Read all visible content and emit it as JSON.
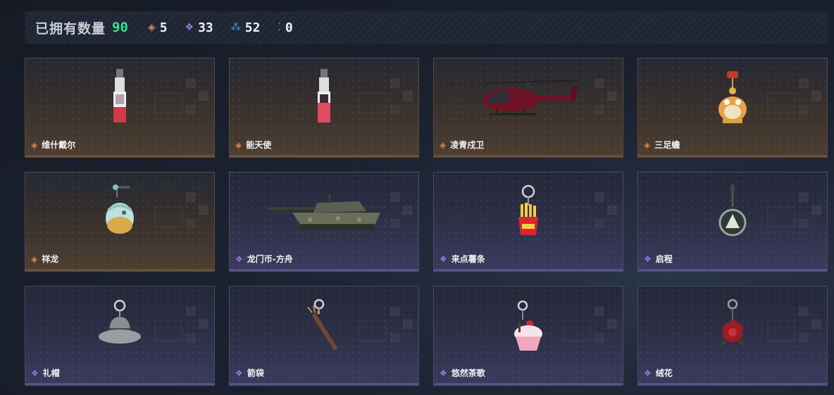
{
  "summary": {
    "owned_label": "已拥有数量",
    "owned_count": "90",
    "stats": [
      {
        "rarity": "orange",
        "icon": "orange-diamond-icon",
        "color": "#d7874c",
        "count": "5"
      },
      {
        "rarity": "purple",
        "icon": "purple-diamond-icon",
        "color": "#9a76ea",
        "count": "33"
      },
      {
        "rarity": "blue",
        "icon": "blue-triangle-icon",
        "color": "#5a93e6",
        "count": "52"
      },
      {
        "rarity": "green",
        "icon": "green-dots-icon",
        "color": "#2fd19a",
        "count": "0"
      }
    ]
  },
  "items": [
    {
      "name": "维什戴尔",
      "rarity": "orange",
      "icon": "sticker-charm"
    },
    {
      "name": "能天使",
      "rarity": "orange",
      "icon": "sticker-charm"
    },
    {
      "name": "凌青戍卫",
      "rarity": "orange",
      "icon": "helicopter"
    },
    {
      "name": "三足蟾",
      "rarity": "orange",
      "icon": "toad-charm"
    },
    {
      "name": "祥龙",
      "rarity": "orange",
      "icon": "dragon-charm"
    },
    {
      "name": "龙门币-方舟",
      "rarity": "purple",
      "icon": "tank"
    },
    {
      "name": "来点薯条",
      "rarity": "purple",
      "icon": "fries-charm"
    },
    {
      "name": "启程",
      "rarity": "purple",
      "icon": "medal-charm"
    },
    {
      "name": "礼帽",
      "rarity": "purple",
      "icon": "hat-charm"
    },
    {
      "name": "箭袋",
      "rarity": "purple",
      "icon": "quiver-charm"
    },
    {
      "name": "悠然茶歌",
      "rarity": "purple",
      "icon": "cupcake-charm"
    },
    {
      "name": "绒花",
      "rarity": "purple",
      "icon": "rose-charm"
    }
  ],
  "colors": {
    "owned_count": "#2fe58a",
    "orange": "#d7874c",
    "purple": "#9a76ea"
  }
}
